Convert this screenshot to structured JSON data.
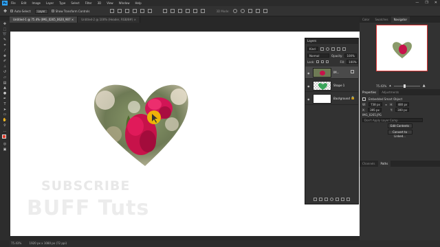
{
  "menu": {
    "logo": "Ps",
    "items": [
      "File",
      "Edit",
      "Image",
      "Layer",
      "Type",
      "Select",
      "Filter",
      "3D",
      "View",
      "Window",
      "Help"
    ],
    "window_controls": [
      "—",
      "❐",
      "✕"
    ]
  },
  "options": {
    "auto_select_label": "Auto-Select:",
    "auto_select_value": "Layer",
    "transform_label": "Show Transform Controls",
    "mode_3d": "3D Mode:"
  },
  "tabs": [
    {
      "label": "Untitled-1 @ 75.4% (IMG_0265_0620_907 ×"
    },
    {
      "label": "Untitled-2 @ 100% (Header, RGB/8#) ×"
    }
  ],
  "canvas": {
    "watermark_line1": "SUBSCRIBE",
    "watermark_line2": "BUFF Tuts"
  },
  "status": {
    "zoom": "75.43%",
    "doc_size": "1920 px x 1080 px (72 ppi)"
  },
  "layers_panel": {
    "title": "Layers",
    "kind_label": "Kind",
    "blend_mode": "Normal",
    "opacity_label": "Opacity:",
    "opacity_value": "100%",
    "lock_label": "Lock:",
    "fill_label": "Fill:",
    "fill_value": "100%",
    "layers": [
      {
        "name": "IM...",
        "type": "smart-object"
      },
      {
        "name": "Shape 1",
        "type": "shape"
      },
      {
        "name": "Background",
        "type": "background"
      }
    ]
  },
  "right_panel": {
    "top_tabs": [
      "Color",
      "Swatches",
      "Navigator"
    ],
    "navigator_zoom": "75.43%",
    "prop_tabs": [
      "Properties",
      "Adjustments"
    ],
    "smart_object_label": "Embedded Smart Object",
    "w_label": "W:",
    "w_value": "738 px",
    "h_label": "H:",
    "h_value": "480 px",
    "x_label": "X:",
    "x_value": "395 px",
    "y_label": "Y:",
    "y_value": "300 px",
    "filename": "IMG_0265.JPG",
    "layer_comp": "Don't Apply Layer Comp",
    "edit_button": "Edit Contents",
    "convert_button": "Convert to Linked...",
    "bottom_tabs": [
      "Channels",
      "Paths"
    ]
  },
  "colors": {
    "accent": "#31a8ff",
    "foreground_swatch": "#e23a2a",
    "shape_green": "#3aa55a",
    "cursor_ring": "#f2c200"
  }
}
